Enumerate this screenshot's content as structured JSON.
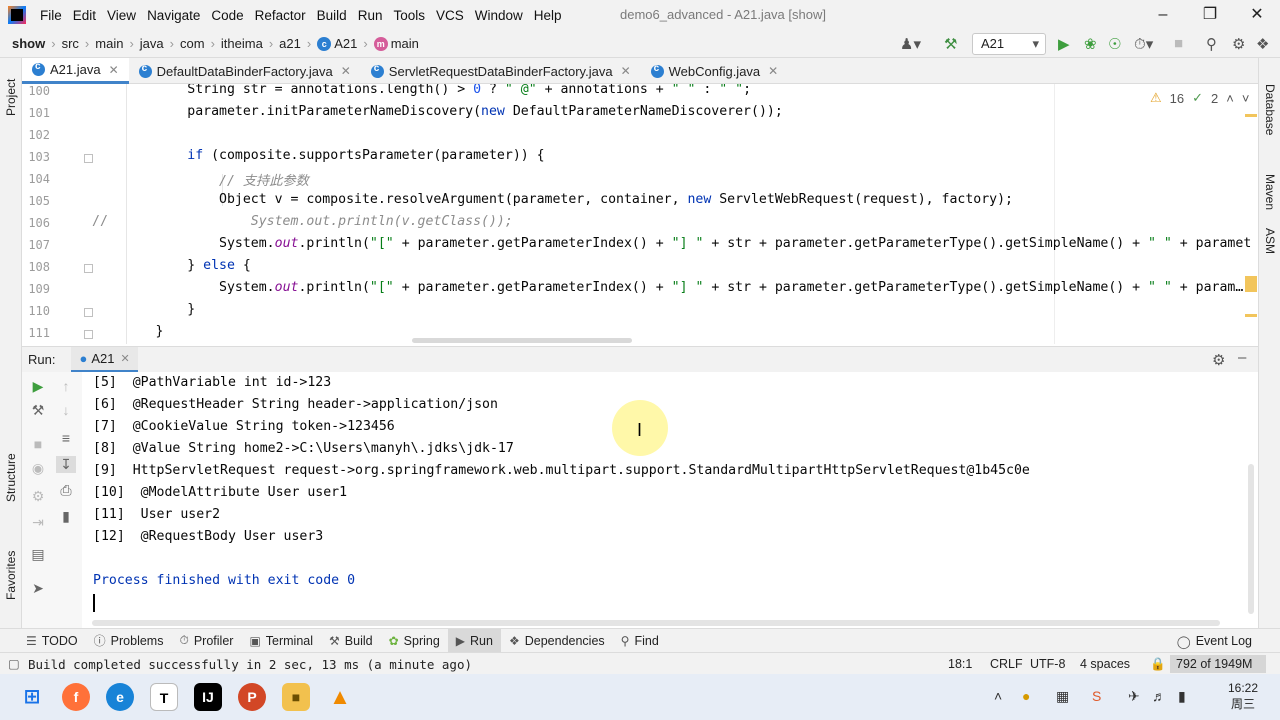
{
  "menubar": {
    "items": [
      "File",
      "Edit",
      "View",
      "Navigate",
      "Code",
      "Refactor",
      "Build",
      "Run",
      "Tools",
      "VCS",
      "Window",
      "Help"
    ],
    "window_title": "demo6_advanced - A21.java [show]"
  },
  "navbar": {
    "crumbs": [
      "show",
      "src",
      "main",
      "java",
      "com",
      "itheima",
      "a21",
      "A21",
      "main"
    ],
    "run_config": "A21"
  },
  "editor_tabs": [
    {
      "label": "A21.java"
    },
    {
      "label": "DefaultDataBinderFactory.java"
    },
    {
      "label": "ServletRequestDataBinderFactory.java"
    },
    {
      "label": "WebConfig.java"
    }
  ],
  "inspections": {
    "warnings": "16",
    "weak_warnings": "2"
  },
  "editor": {
    "line_numbers": [
      "100",
      "101",
      "102",
      "103",
      "104",
      "105",
      "106",
      "107",
      "108",
      "109",
      "110",
      "111"
    ],
    "lines": {
      "l100a": "            String str = annotations.length() > ",
      "l100b": "0",
      "l100c": " ? ",
      "l100d": "\" @\"",
      "l100e": " + annotations + ",
      "l100f": "\" \"",
      "l100g": " : ",
      "l100h": "\" \"",
      "l100i": ";",
      "l101a": "            parameter.initParameterNameDiscovery(",
      "l101b": "new",
      "l101c": " DefaultParameterNameDiscoverer());",
      "l103a": "            ",
      "l103b": "if",
      "l103c": " (composite.supportsParameter(parameter)) {",
      "l104": "                // 支持此参数",
      "l105a": "                Object v = composite.resolveArgument(parameter, container, ",
      "l105b": "new",
      "l105c": " ServletWebRequest(request), factory);",
      "l106a": "//",
      "l106b": "                  System.out.println(v.getClass());",
      "l107a": "                System.",
      "l107b": "out",
      "l107c": ".println(",
      "l107d": "\"[\"",
      "l107e": " + parameter.getParameterIndex() + ",
      "l107f": "\"] \"",
      "l107g": " + str + parameter.getParameterType().getSimpleName() + ",
      "l107h": "\" \"",
      "l107i": " + paramet",
      "l108a": "            } ",
      "l108b": "else",
      "l108c": " {",
      "l109a": "                System.",
      "l109b": "out",
      "l109c": ".println(",
      "l109d": "\"[\"",
      "l109e": " + parameter.getParameterIndex() + ",
      "l109f": "\"] \"",
      "l109g": " + str + parameter.getParameterType().getSimpleName() + ",
      "l109h": "\" \"",
      "l109i": " + param…",
      "l110": "            }",
      "l111": "        }"
    }
  },
  "run_panel": {
    "label": "Run:",
    "tab": "A21",
    "output": [
      "[5]  @PathVariable int id->123",
      "[6]  @RequestHeader String header->application/json",
      "[7]  @CookieValue String token->123456",
      "[8]  @Value String home2->C:\\Users\\manyh\\.jdks\\jdk-17",
      "[9]  HttpServletRequest request->org.springframework.web.multipart.support.StandardMultipartHttpServletRequest@1b45c0e",
      "[10]  @ModelAttribute User user1",
      "[11]  User user2",
      "[12]  @RequestBody User user3"
    ],
    "exit_message": "Process finished with exit code 0"
  },
  "bottom_tools": [
    "TODO",
    "Problems",
    "Profiler",
    "Terminal",
    "Build",
    "Spring",
    "Run",
    "Dependencies",
    "Find"
  ],
  "event_log": "Event Log",
  "statusbar": {
    "message": "Build completed successfully in 2 sec, 13 ms (a minute ago)",
    "position": "18:1",
    "line_sep": "CRLF",
    "encoding": "UTF-8",
    "indent": "4 spaces",
    "memory": "792 of 1949M"
  },
  "side_labels": {
    "project": "Project",
    "structure": "Structure",
    "favorites": "Favorites",
    "database": "Database",
    "maven": "Maven",
    "asm": "ASM"
  },
  "taskbar": {
    "time": "16:22",
    "day": "周三"
  },
  "colors": {
    "accent": "#4083c9",
    "keyword": "#0033b3",
    "string": "#067d17",
    "comment": "#8c8c8c"
  }
}
